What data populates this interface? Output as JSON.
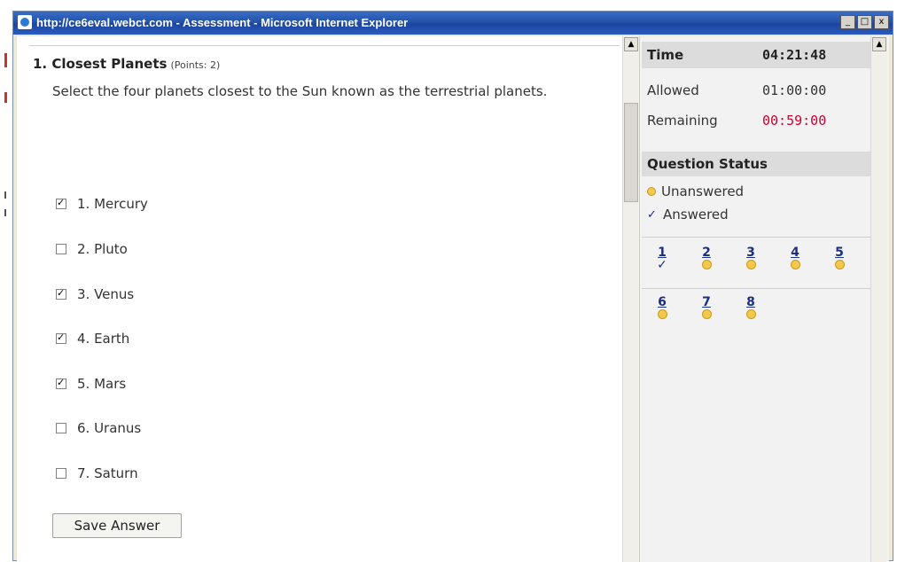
{
  "window": {
    "title": "http://ce6eval.webct.com - Assessment - Microsoft Internet Explorer",
    "buttons": {
      "minimize": "_",
      "maximize": "□",
      "close": "x"
    }
  },
  "question": {
    "number_title": "1. Closest Planets",
    "points": "(Points: 2)",
    "text": "Select the four planets closest to the Sun known as the terrestrial planets.",
    "choices": [
      {
        "label": "1. Mercury",
        "checked": true
      },
      {
        "label": "2. Pluto",
        "checked": false
      },
      {
        "label": "3. Venus",
        "checked": true
      },
      {
        "label": "4. Earth",
        "checked": true
      },
      {
        "label": "5. Mars",
        "checked": true
      },
      {
        "label": "6. Uranus",
        "checked": false
      },
      {
        "label": "7. Saturn",
        "checked": false
      }
    ],
    "save_label": "Save Answer"
  },
  "sidebar": {
    "time_label": "Time",
    "time_value": "04:21:48",
    "allowed_label": "Allowed",
    "allowed_value": "01:00:00",
    "remaining_label": "Remaining",
    "remaining_value": "00:59:00",
    "status_title": "Question Status",
    "legend_unanswered": "Unanswered",
    "legend_answered": "Answered",
    "questions": [
      {
        "num": "1",
        "status": "answered"
      },
      {
        "num": "2",
        "status": "unanswered"
      },
      {
        "num": "3",
        "status": "unanswered"
      },
      {
        "num": "4",
        "status": "unanswered"
      },
      {
        "num": "5",
        "status": "unanswered"
      },
      {
        "num": "6",
        "status": "unanswered"
      },
      {
        "num": "7",
        "status": "unanswered"
      },
      {
        "num": "8",
        "status": "unanswered"
      }
    ]
  },
  "colors": {
    "remaining": "#cc0033",
    "link": "#1a2f80",
    "titlebar": "#2353a8",
    "unanswered_circle": "#f4c84a"
  }
}
